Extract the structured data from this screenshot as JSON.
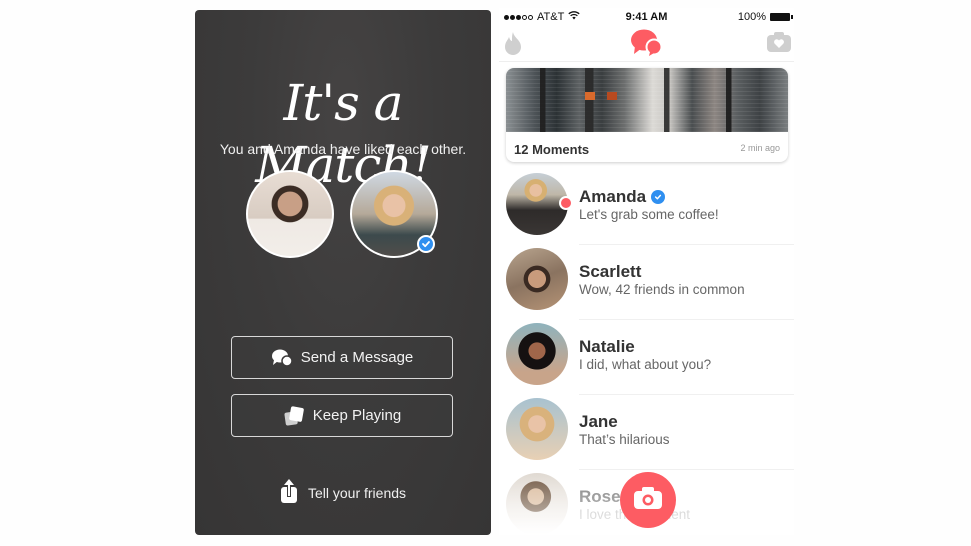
{
  "match_screen": {
    "title": "It's a Match!",
    "subtitle": "You and Amanda have liked each other.",
    "user_avatar": "user-photo",
    "match_avatar": "amanda-photo",
    "match_verified": true,
    "buttons": {
      "send_message": {
        "label": "Send a Message",
        "icon": "chat-bubbles-icon"
      },
      "keep_playing": {
        "label": "Keep Playing",
        "icon": "cards-icon"
      }
    },
    "tell_friends": {
      "label": "Tell your friends",
      "icon": "share-icon"
    }
  },
  "messages_screen": {
    "status_bar": {
      "carrier": "AT&T",
      "signal_bars": 3,
      "signal_total": 5,
      "time": "9:41 AM",
      "battery": "100%"
    },
    "nav": {
      "left_icon": "flame-icon",
      "center_icon": "chat-bubbles-icon",
      "right_icon": "moments-camera-icon"
    },
    "moments": {
      "title": "12 Moments",
      "time": "2 min ago"
    },
    "conversations": [
      {
        "name": "Amanda",
        "message": "Let's grab some coffee!",
        "verified": true,
        "unread": true
      },
      {
        "name": "Scarlett",
        "message": "Wow, 42 friends in common",
        "verified": false,
        "unread": false
      },
      {
        "name": "Natalie",
        "message": "I did, what about you?",
        "verified": false,
        "unread": false
      },
      {
        "name": "Jane",
        "message": "That’s hilarious",
        "verified": false,
        "unread": false
      },
      {
        "name": "Rose",
        "message": "I love that Moment",
        "verified": false,
        "unread": false
      }
    ],
    "fab": {
      "icon": "camera-icon"
    },
    "colors": {
      "accent": "#fd5c63",
      "verified": "#2f8ff0",
      "match_bg": "#3c3b3b"
    }
  }
}
